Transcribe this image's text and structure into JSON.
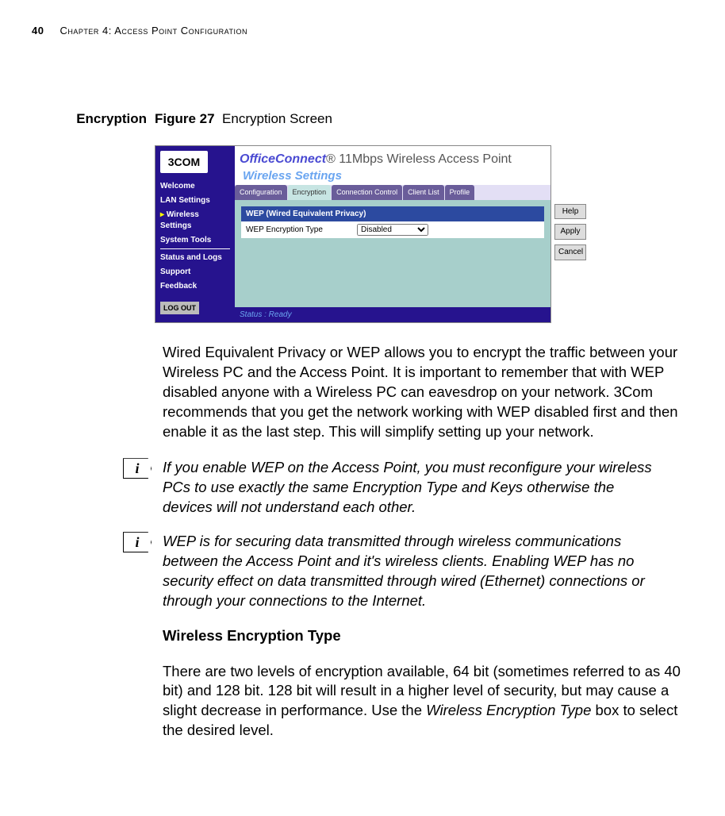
{
  "header": {
    "page_number": "40",
    "chapter": "Chapter 4: Access Point Configuration"
  },
  "section": {
    "title": "Encryption"
  },
  "figure": {
    "label": "Figure 27",
    "caption": "Encryption Screen"
  },
  "screenshot": {
    "logo": "3COM",
    "nav": [
      "Welcome",
      "LAN Settings",
      "Wireless Settings",
      "System Tools",
      "Status and Logs",
      "Support",
      "Feedback"
    ],
    "nav_active_index": 2,
    "logout": "LOG OUT",
    "brand": "OfficeConnect",
    "brand_suffix": "® 11Mbps Wireless Access Point",
    "subhead": "Wireless Settings",
    "tabs": [
      "Configuration",
      "Encryption",
      "Connection Control",
      "Client List",
      "Profile"
    ],
    "tab_active_index": 1,
    "wep_title": "WEP (Wired Equivalent Privacy)",
    "wep_label": "WEP Encryption Type",
    "wep_value": "Disabled",
    "buttons": [
      "Help",
      "Apply",
      "Cancel"
    ],
    "status": "Status : Ready"
  },
  "paragraphs": {
    "intro": "Wired Equivalent Privacy or WEP allows you to encrypt the traffic between your Wireless PC and the Access Point. It is important to remember that with WEP disabled anyone with a Wireless PC can eavesdrop on your network. 3Com recommends that you get the network working with WEP disabled first and then enable it as the last step. This will simplify setting up your network.",
    "note1": "If you enable WEP on the Access Point, you must reconfigure your wireless PCs to use exactly the same Encryption Type and Keys otherwise the devices will not understand each other.",
    "note2": "WEP is for securing data transmitted through wireless communications between the Access Point and it's wireless clients. Enabling WEP has no security effect on data transmitted through wired (Ethernet) connections or through your connections to the Internet.",
    "h3": "Wireless Encryption Type",
    "body2a": "There are two levels of encryption available, 64 bit (sometimes referred to as 40 bit) and 128 bit. 128 bit will result in a higher level of security, but may cause a slight decrease in performance. Use the ",
    "body2_em": "Wireless Encryption Type",
    "body2b": " box to select the desired level."
  },
  "icons": {
    "info_glyph": "i"
  }
}
